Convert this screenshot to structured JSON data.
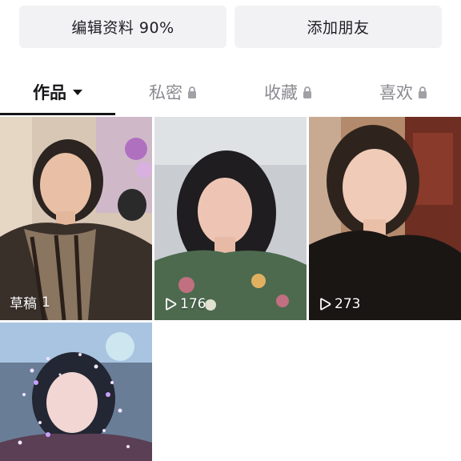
{
  "actions": {
    "edit_profile": "编辑资料 90%",
    "add_friend": "添加朋友"
  },
  "tabs": [
    {
      "label": "作品",
      "active": true,
      "icon": "caret-down-icon"
    },
    {
      "label": "私密",
      "active": false,
      "icon": "lock-icon"
    },
    {
      "label": "收藏",
      "active": false,
      "icon": "lock-icon"
    },
    {
      "label": "喜欢",
      "active": false,
      "icon": "lock-icon"
    }
  ],
  "videos": [
    {
      "kind": "draft",
      "label": "草稿",
      "count": "1"
    },
    {
      "kind": "video",
      "plays": "176",
      "icon": "play-icon"
    },
    {
      "kind": "video",
      "plays": "273",
      "icon": "play-icon"
    },
    {
      "kind": "video"
    }
  ],
  "colors": {
    "active_text": "#151518",
    "inactive_text": "#8a8a90",
    "button_bg": "#f2f2f4"
  }
}
